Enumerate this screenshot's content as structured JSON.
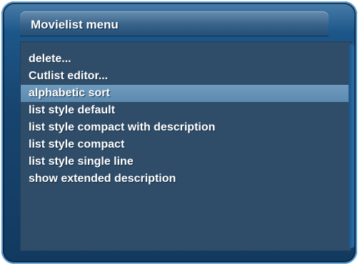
{
  "window": {
    "title": "Movielist menu"
  },
  "menu": {
    "selected_index": 2,
    "items": [
      {
        "label": "delete..."
      },
      {
        "label": "Cutlist editor..."
      },
      {
        "label": "alphabetic sort"
      },
      {
        "label": "list style default"
      },
      {
        "label": "list style compact with description"
      },
      {
        "label": "list style compact"
      },
      {
        "label": "list style single line"
      },
      {
        "label": "show extended description"
      }
    ]
  },
  "colors": {
    "frame": "#1f5f95",
    "panel": "#2f4d69",
    "selection": "#6f9bbd",
    "text": "#ffffff"
  }
}
